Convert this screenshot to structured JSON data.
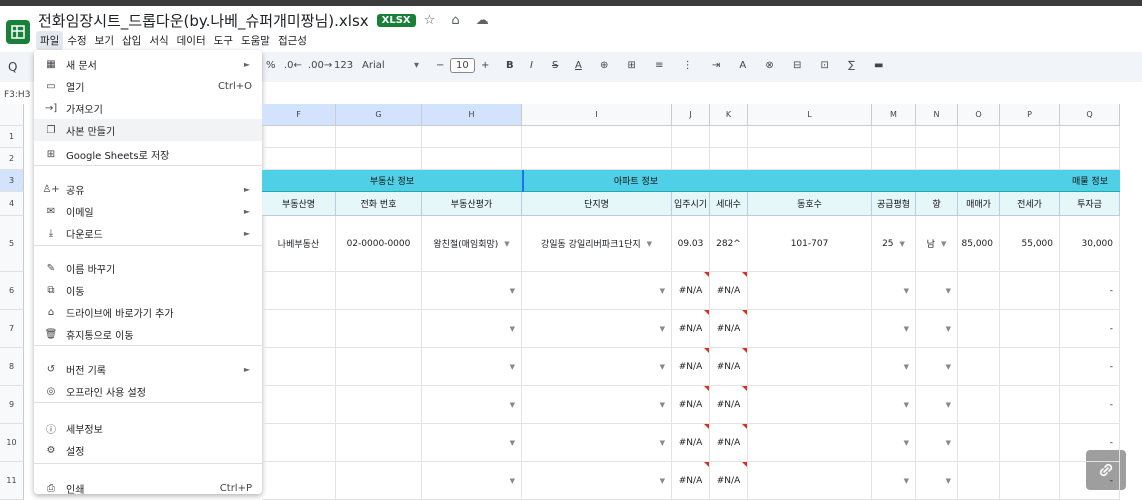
{
  "app": {
    "title": "전화임장시트_드롭다운(by.나베_슈퍼개미짱님).xlsx",
    "badge": "XLSX",
    "title_icons": "☆ ⌂ ☁"
  },
  "menubar": [
    "파일",
    "수정",
    "보기",
    "삽입",
    "서식",
    "데이터",
    "도구",
    "도움말",
    "접근성"
  ],
  "toolbar": {
    "percent": "%",
    "dec_dec": ".0←",
    "dec_inc": ".00→",
    "fmt_123": "123",
    "font": "Arial",
    "minus": "−",
    "font_size": "10",
    "plus": "+",
    "bold": "B",
    "italic": "I",
    "strike": "S",
    "underline": "A",
    "tools": "⊕ ⊞ ≡ ⋮ ⇥ A ⊗ ⊟ ⊡ ∑ ▬"
  },
  "namebox": "F3:H3",
  "columns": [
    {
      "label": "F",
      "w": 74,
      "sel": true
    },
    {
      "label": "G",
      "w": 86,
      "sel": true
    },
    {
      "label": "H",
      "w": 100,
      "sel": true
    },
    {
      "label": "I",
      "w": 150
    },
    {
      "label": "J",
      "w": 38
    },
    {
      "label": "K",
      "w": 38
    },
    {
      "label": "L",
      "w": 124
    },
    {
      "label": "M",
      "w": 44
    },
    {
      "label": "N",
      "w": 42
    },
    {
      "label": "O",
      "w": 42
    },
    {
      "label": "P",
      "w": 60
    },
    {
      "label": "Q",
      "w": 60
    }
  ],
  "rows": [
    "1",
    "2",
    "3",
    "4",
    "5",
    "6",
    "7",
    "8",
    "9",
    "10",
    "11"
  ],
  "bands": {
    "realestate": "부동산 정보",
    "apartment": "아파트 정보",
    "listing": "매물 정보"
  },
  "headers": [
    "부동산명",
    "전화 번호",
    "부동산평가",
    "단지명",
    "입주시기",
    "세대수",
    "동호수",
    "공급평형",
    "향",
    "매매가",
    "전세가",
    "투자금"
  ],
  "row5": [
    "나베부동산",
    "02-0000-0000",
    "왕친절(매임회망)",
    "강일동 강일리버파크1단지",
    "09.03",
    "282^",
    "101-707",
    "25",
    "남",
    "85,000",
    "55,000",
    "30,000"
  ],
  "na": "#N/A",
  "dash": "-",
  "file_menu": {
    "items": [
      {
        "icon": "▦",
        "label": "새 문서",
        "arrow": "►"
      },
      {
        "icon": "▭",
        "label": "열기",
        "shortcut": "Ctrl+O"
      },
      {
        "icon": "→]",
        "label": "가져오기"
      },
      {
        "icon": "❐",
        "label": "사본 만들기"
      },
      {
        "icon": "⊞",
        "label": "Google Sheets로 저장"
      },
      {
        "icon": "♙+",
        "label": "공유",
        "arrow": "►"
      },
      {
        "icon": "✉",
        "label": "이메일",
        "arrow": "►"
      },
      {
        "icon": "⤓",
        "label": "다운로드",
        "arrow": "►"
      },
      {
        "icon": "✎",
        "label": "이름 바꾸기"
      },
      {
        "icon": "⧉",
        "label": "이동"
      },
      {
        "icon": "⌂",
        "label": "드라이브에 바로가기 추가"
      },
      {
        "icon": "🗑",
        "label": "휴지통으로 이동"
      },
      {
        "icon": "↺",
        "label": "버전 기록",
        "arrow": "►"
      },
      {
        "icon": "◎",
        "label": "오프라인 사용 설정"
      },
      {
        "icon": "ⓘ",
        "label": "세부정보"
      },
      {
        "icon": "⚙",
        "label": "설정"
      },
      {
        "icon": "⎙",
        "label": "인쇄",
        "shortcut": "Ctrl+P"
      }
    ]
  },
  "fab_icon": "link-icon"
}
